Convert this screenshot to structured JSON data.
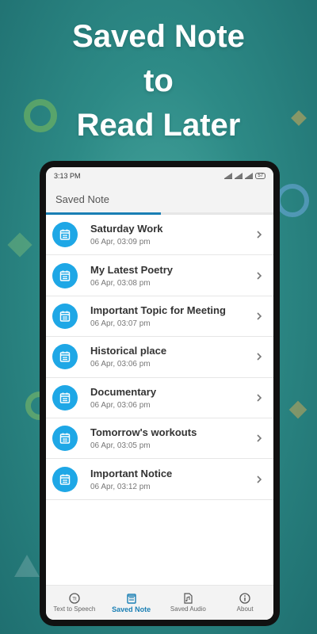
{
  "headline": {
    "line1": "Saved Note",
    "line2": "to",
    "line3": "Read Later"
  },
  "colors": {
    "accent": "#1a7fb4",
    "icon_bg": "#1ea7e6",
    "background": "#2d8a86"
  },
  "statusbar": {
    "time": "3:13 PM",
    "battery": "57"
  },
  "appbar": {
    "title": "Saved Note"
  },
  "notes": [
    {
      "title": "Saturday Work",
      "date": "06 Apr, 03:09 pm"
    },
    {
      "title": "My Latest Poetry",
      "date": "06 Apr, 03:08 pm"
    },
    {
      "title": "Important Topic for Meeting",
      "date": "06 Apr, 03:07 pm"
    },
    {
      "title": "Historical place",
      "date": "06 Apr, 03:06 pm"
    },
    {
      "title": "Documentary",
      "date": "06 Apr, 03:06 pm"
    },
    {
      "title": "Tomorrow's workouts",
      "date": "06 Apr, 03:05 pm"
    },
    {
      "title": "Important Notice",
      "date": "06 Apr, 03:12 pm"
    }
  ],
  "tabs": [
    {
      "label": "Text to Speech",
      "icon": "speech-icon"
    },
    {
      "label": "Saved Note",
      "icon": "note-icon"
    },
    {
      "label": "Saved Audio",
      "icon": "audio-file-icon"
    },
    {
      "label": "About",
      "icon": "info-icon"
    }
  ],
  "active_tab": "Saved Note"
}
